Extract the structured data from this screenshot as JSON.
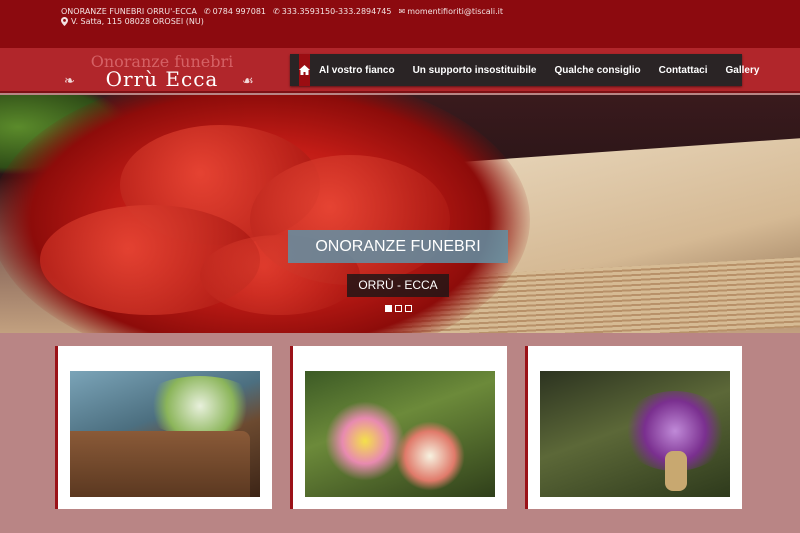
{
  "topbar": {
    "company": "ONORANZE FUNEBRI ORRU'-ECCA",
    "phone1": "0784 997081",
    "phone2": "333.3593150-333.2894745",
    "email": "momentifioriti@tiscali.it",
    "address": "V. Satta, 115 08028 OROSEI (NU)"
  },
  "logo": {
    "line1": "Onoranze funebri",
    "line2": "Orrù Ecca"
  },
  "nav": {
    "items": [
      {
        "label": "Al vostro fianco"
      },
      {
        "label": "Un supporto insostituibile"
      },
      {
        "label": "Qualche consiglio"
      },
      {
        "label": "Contattaci"
      },
      {
        "label": "Gallery"
      }
    ]
  },
  "hero": {
    "title": "ONORANZE FUNEBRI",
    "subtitle": "ORRÙ - ECCA",
    "slides": 3,
    "active_slide": 1
  },
  "icons": {
    "phone": "phone-icon",
    "email": "envelope-icon",
    "location": "map-marker-icon",
    "home": "home-icon"
  },
  "colors": {
    "topbar": "#8c0a0f",
    "header": "#b1262b",
    "nav": "#2a2425",
    "accent": "#9b0d12",
    "background": "#b98585"
  }
}
